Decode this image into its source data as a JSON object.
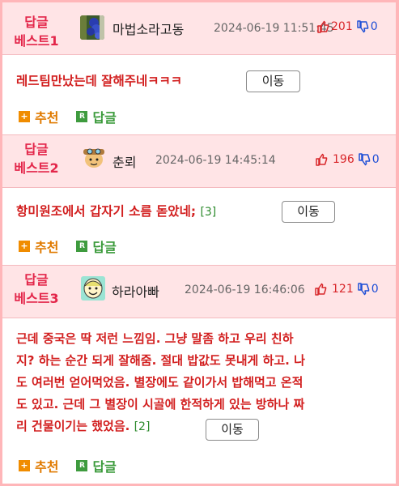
{
  "comments": [
    {
      "badge_line1": "답글",
      "badge_line2": "베스트1",
      "avatar_icon": "blue-flower-avatar-icon",
      "nickname": "마법소라고동",
      "date": "2024-06-19 11:51:45",
      "upvotes": "201",
      "downvotes": "0",
      "lines": [
        "레드팀만났는데 잘해주네ㅋㅋㅋ"
      ],
      "reply_count": "",
      "move_label": "이동",
      "recommend_label": "추천",
      "reply_label": "답글"
    },
    {
      "badge_line1": "답글",
      "badge_line2": "베스트2",
      "avatar_icon": "cartoon-character-avatar-icon",
      "nickname": "춘뢰",
      "date": "2024-06-19 14:45:14",
      "upvotes": "196",
      "downvotes": "0",
      "lines": [
        "항미원조에서 갑자기 소름 돋았네;"
      ],
      "reply_count": "[3]",
      "move_label": "이동",
      "recommend_label": "추천",
      "reply_label": "답글"
    },
    {
      "badge_line1": "답글",
      "badge_line2": "베스트3",
      "avatar_icon": "smiling-face-avatar-icon",
      "nickname": "하라아빠",
      "date": "2024-06-19 16:46:06",
      "upvotes": "121",
      "downvotes": "0",
      "lines": [
        "근데 중국은 딱 저런 느낌임. 그냥 말좀 하고 우리 친하",
        "지? 하는 순간 되게 잘해줌. 절대 밥값도 못내게 하고. 나",
        "도 여러번 얻어먹었음. 별장에도 같이가서 밥해먹고 온적",
        "도 있고. 근데 그 별장이 시골에 한적하게 있는 방하나 짜",
        "리 건물이기는 했었음."
      ],
      "reply_count": "[2]",
      "move_label": "이동",
      "recommend_label": "추천",
      "reply_label": "답글"
    }
  ],
  "colors": {
    "badge": "#e3264a",
    "content": "#d21f1f",
    "header_bg": "#ffe4e6",
    "border": "#ffb6b9",
    "upvote": "#d8262a",
    "downvote": "#1f4fd6",
    "recommend": "#e07a00",
    "reply": "#3a9a3a"
  }
}
